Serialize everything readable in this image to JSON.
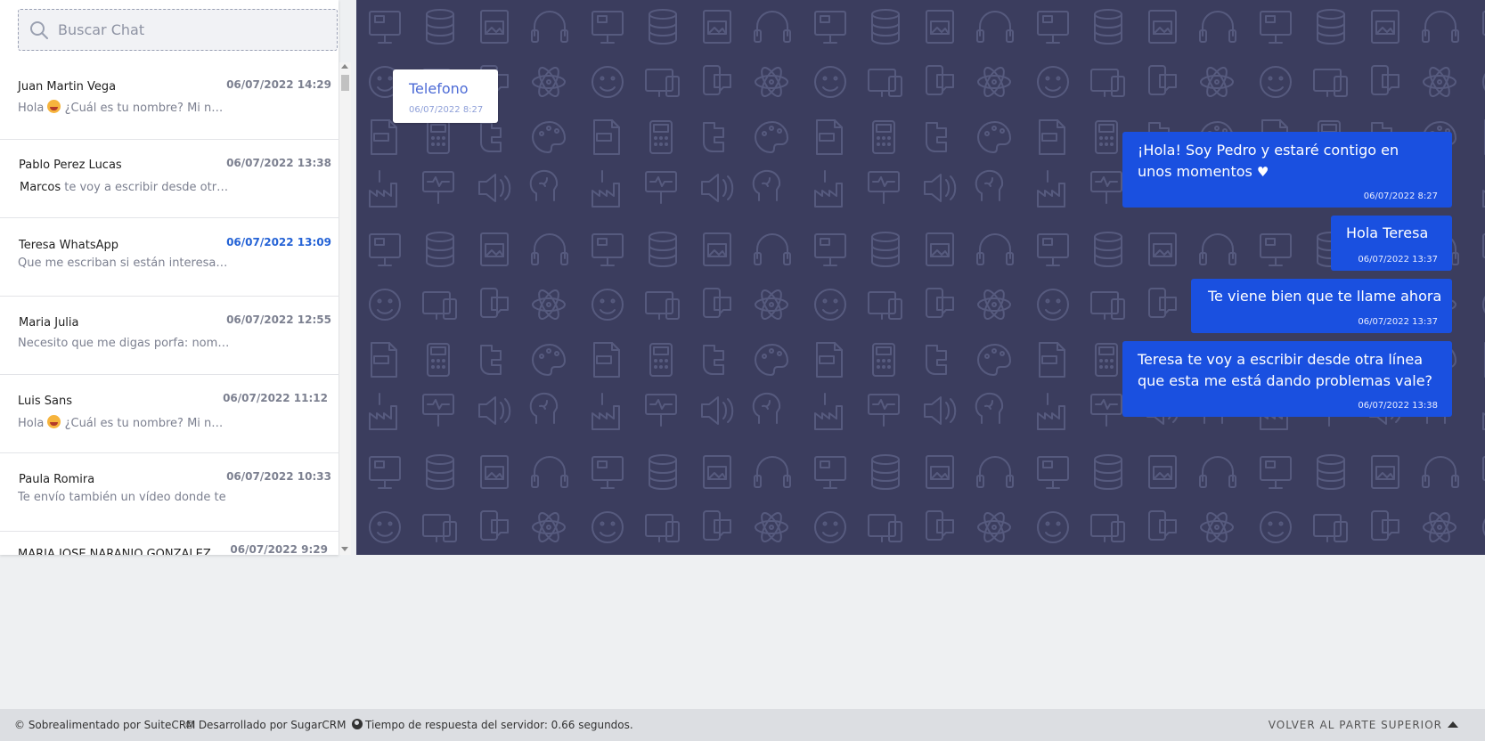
{
  "search": {
    "placeholder": "Buscar Chat"
  },
  "chats": [
    {
      "name": "Juan Martin Vega",
      "date": "06/07/2022 14:29",
      "active": false,
      "preview_prefix": "Hola ",
      "has_emoji": true,
      "preview_highlight": "",
      "preview": " ¿Cuál es tu nombre? Mi nombre es"
    },
    {
      "name": "Pablo Perez Lucas",
      "date": "06/07/2022 13:38",
      "active": false,
      "preview_prefix": "",
      "has_emoji": false,
      "preview_highlight": "Marcos",
      "preview": " te voy a escribir desde otra línea"
    },
    {
      "name": "Teresa WhatsApp",
      "date": "06/07/2022 13:09",
      "active": true,
      "preview_prefix": "",
      "has_emoji": false,
      "preview_highlight": "",
      "preview": "Que me escriban si están interesados"
    },
    {
      "name": "Maria Julia",
      "date": "06/07/2022 12:55",
      "active": false,
      "preview_prefix": "",
      "has_emoji": false,
      "preview_highlight": "",
      "preview": "Necesito que me digas porfa: nombre"
    },
    {
      "name": "Luis Sans",
      "date": "06/07/2022 11:12",
      "active": false,
      "preview_prefix": "Hola ",
      "has_emoji": true,
      "preview_highlight": "",
      "preview": " ¿Cuál es tu nombre? Mi nombre es"
    },
    {
      "name": "Paula Romira",
      "date": "06/07/2022 10:33",
      "active": false,
      "preview_prefix": "",
      "has_emoji": false,
      "preview_highlight": "",
      "preview": "Te envío también un vídeo donde te"
    },
    {
      "name": "MARIA JOSE NARANJO GONZALEZ",
      "date": "06/07/2022 9:29",
      "active": false,
      "preview_prefix": "",
      "has_emoji": false,
      "preview_highlight": "",
      "preview": ""
    }
  ],
  "incoming_message": {
    "text": "Telefono",
    "time": "06/07/2022 8:27"
  },
  "outgoing_messages": [
    {
      "line1": "¡Hola! Soy  Pedro  y estaré contigo en",
      "line2": "unos momentos ",
      "has_heart": true,
      "time": "06/07/2022 8:27"
    },
    {
      "line1": "Hola  Teresa",
      "line2": "",
      "has_heart": false,
      "time": "06/07/2022 13:37"
    },
    {
      "line1": "Te viene bien que te llame ahora",
      "line2": "",
      "has_heart": false,
      "time": "06/07/2022 13:37"
    },
    {
      "line1": " Teresa  te voy a escribir desde otra línea",
      "line2": "que esta me está dando problemas vale?",
      "has_heart": false,
      "time": "06/07/2022 13:38"
    }
  ],
  "footer": {
    "powered_by": "© Sobrealimentado por SuiteCRM",
    "developed_by": "© Desarrollado por SugarCRM",
    "response_time": "Tiempo de respuesta del servidor: 0.66 segundos.",
    "back_to_top": "VOLVER AL PARTE SUPERIOR"
  },
  "colors": {
    "chat_bg": "#3b3d5e",
    "bubble_out": "#1a50e0",
    "active_date": "#2563d6"
  }
}
